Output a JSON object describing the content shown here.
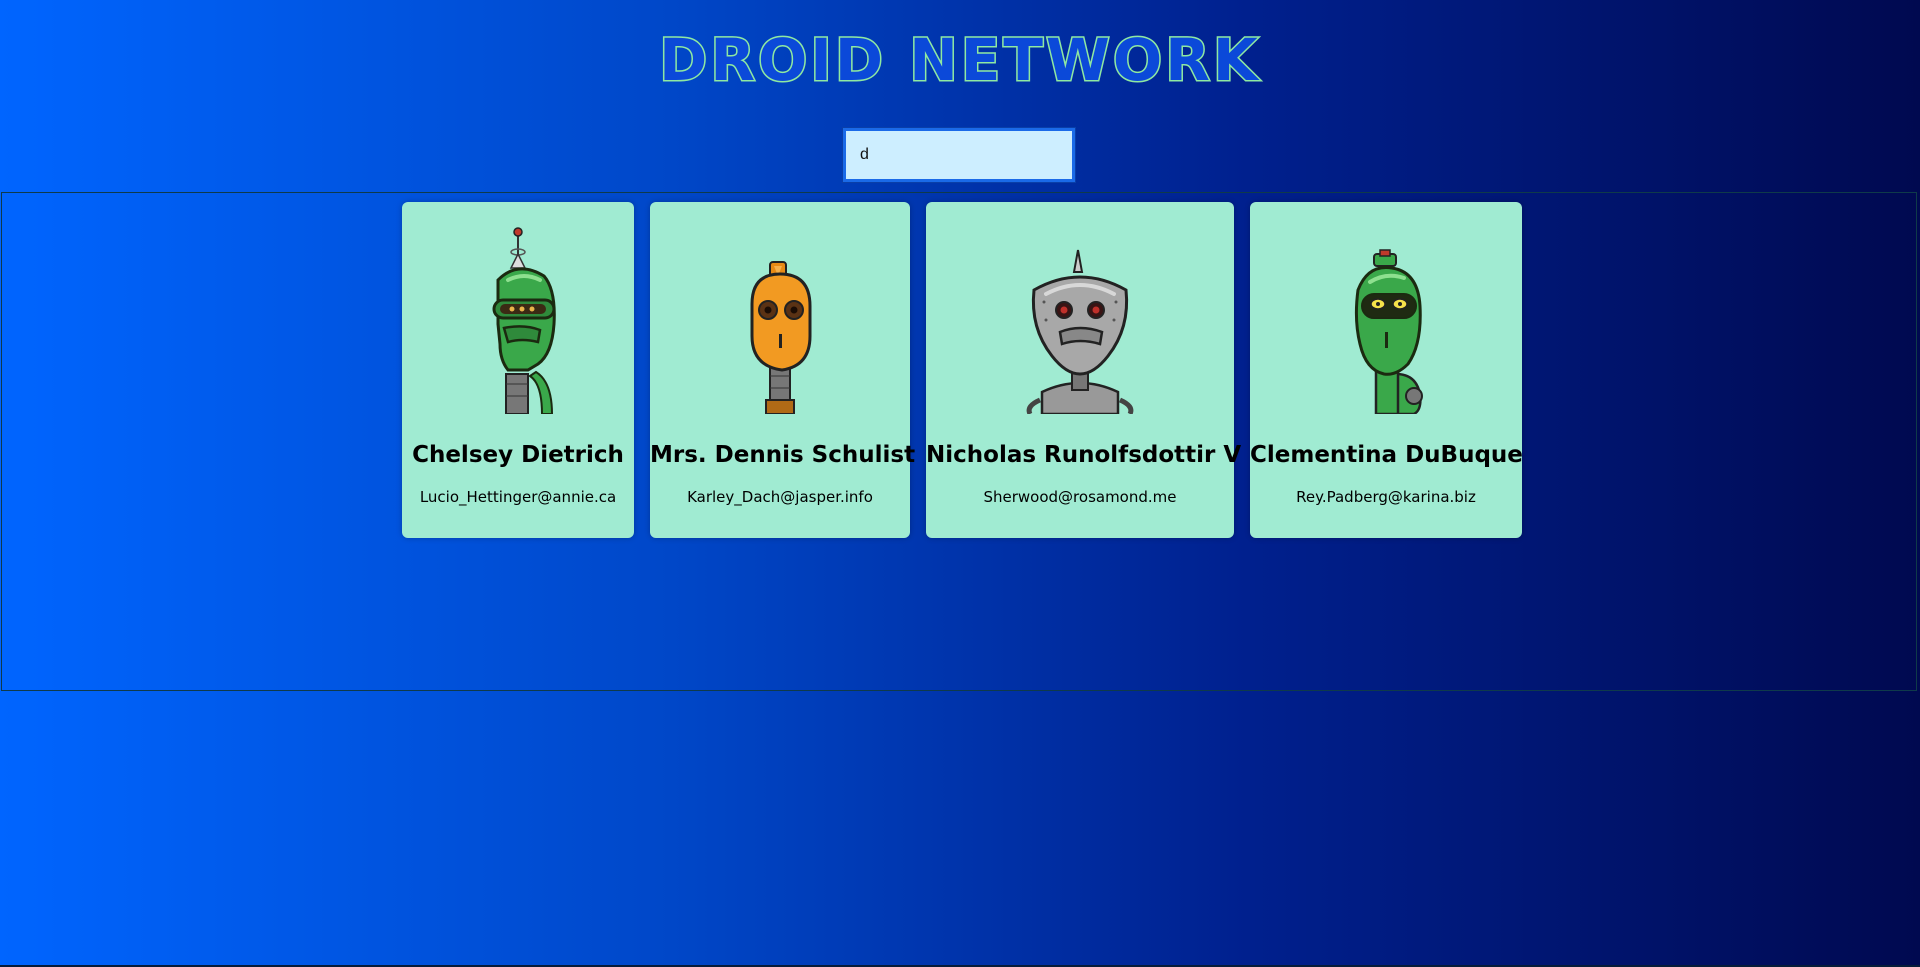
{
  "app": {
    "title": "DROID NETWORK"
  },
  "search": {
    "value": "d"
  },
  "cards": [
    {
      "name": "Chelsey Dietrich",
      "email": "Lucio_Hettinger@annie.ca",
      "robot_icon": "green-robot-icon"
    },
    {
      "name": "Mrs. Dennis Schulist",
      "email": "Karley_Dach@jasper.info",
      "robot_icon": "orange-robot-icon"
    },
    {
      "name": "Nicholas Runolfsdottir V",
      "email": "Sherwood@rosamond.me",
      "robot_icon": "gray-robot-icon"
    },
    {
      "name": "Clementina DuBuque",
      "email": "Rey.Padberg@karina.biz",
      "robot_icon": "green-robot-icon"
    }
  ],
  "colors": {
    "title_stroke": "#8ee8a0",
    "card_background": "#a0ebd2",
    "search_background": "#cdeeff",
    "background_start": "#0065ff",
    "background_end": "#000950"
  }
}
